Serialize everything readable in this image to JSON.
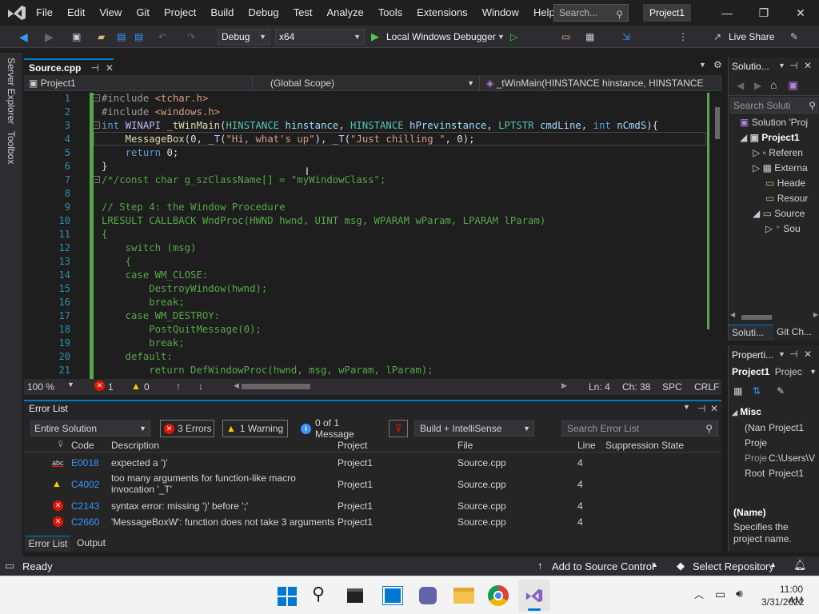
{
  "titlebar": {
    "menu": [
      "File",
      "Edit",
      "View",
      "Git",
      "Project",
      "Build",
      "Debug",
      "Test",
      "Analyze",
      "Tools",
      "Extensions",
      "Window",
      "Help"
    ],
    "search_placeholder": "Search...",
    "project_name": "Project1",
    "min": "—",
    "restore": "❐",
    "close": "✕"
  },
  "toolbar": {
    "config": "Debug",
    "platform": "x64",
    "run_target": "Local Windows Debugger",
    "live_share": "Live Share"
  },
  "left_strip": {
    "server_explorer": "Server Explorer",
    "toolbox": "Toolbox"
  },
  "doc_tab": {
    "label": "Source.cpp"
  },
  "navbar": {
    "project": "Project1",
    "scope": "(Global Scope)",
    "member": "_tWinMain(HINSTANCE hinstance, HINSTANCE"
  },
  "editor": {
    "line_numbers": [
      "1",
      "2",
      "3",
      "4",
      "5",
      "6",
      "7",
      "8",
      "9",
      "10",
      "11",
      "12",
      "13",
      "14",
      "15",
      "16",
      "17",
      "18",
      "19",
      "20",
      "21"
    ]
  },
  "status_line": {
    "zoom": "100 %",
    "errors": "1",
    "warnings": "0",
    "position_ln": "Ln: 4",
    "position_ch": "Ch: 38",
    "spacing": "SPC",
    "line_ending": "CRLF"
  },
  "error_list": {
    "title": "Error List",
    "scope": "Entire Solution",
    "errors_btn": "3 Errors",
    "warnings_btn": "1 Warning",
    "messages_btn": "0 of 1 Message",
    "build_filter": "Build + IntelliSense",
    "search_placeholder": "Search Error List",
    "columns": [
      "Code",
      "Description",
      "Project",
      "File",
      "Line",
      "Suppression State"
    ],
    "rows": [
      {
        "icon": "abc",
        "code": "E0018",
        "desc": "expected a ')'",
        "project": "Project1",
        "file": "Source.cpp",
        "line": "4"
      },
      {
        "icon": "warn",
        "code": "C4002",
        "desc": "too many arguments for function-like macro invocation '_T'",
        "project": "Project1",
        "file": "Source.cpp",
        "line": "4"
      },
      {
        "icon": "err",
        "code": "C2143",
        "desc": "syntax error: missing ')' before ';'",
        "project": "Project1",
        "file": "Source.cpp",
        "line": "4"
      },
      {
        "icon": "err",
        "code": "C2660",
        "desc": "'MessageBoxW': function does not take 3 arguments",
        "project": "Project1",
        "file": "Source.cpp",
        "line": "4"
      }
    ],
    "bottom_tabs": [
      "Error List",
      "Output"
    ]
  },
  "solution_explorer": {
    "title": "Solutio...",
    "search": "Search Soluti",
    "items": [
      "Solution 'Proj",
      "Project1",
      "Referen",
      "Externa",
      "Heade",
      "Resour",
      "Source",
      "Sou"
    ],
    "tabs": [
      "Soluti...",
      "Git Ch..."
    ]
  },
  "properties": {
    "title": "Properti...",
    "selector_name": "Project1",
    "selector_kind": "Projec",
    "category": "Misc",
    "rows": [
      {
        "name": "(Nan",
        "value": "Project1"
      },
      {
        "name": "Proje",
        "value": ""
      },
      {
        "name": "Proje",
        "value": "C:\\Users\\V"
      },
      {
        "name": "Root",
        "value": "Project1"
      }
    ],
    "desc_title": "(Name)",
    "desc_text": "Specifies the project name."
  },
  "statusbar": {
    "ready": "Ready",
    "source_control": "Add to Source Control",
    "repository": "Select Repository"
  },
  "taskbar": {
    "time": "11:00 AM",
    "date": "3/31/2022"
  },
  "colors": {
    "accent": "#007acc",
    "error": "#e51400",
    "warning": "#ffcc00",
    "vs_purple": "#865fc5"
  }
}
